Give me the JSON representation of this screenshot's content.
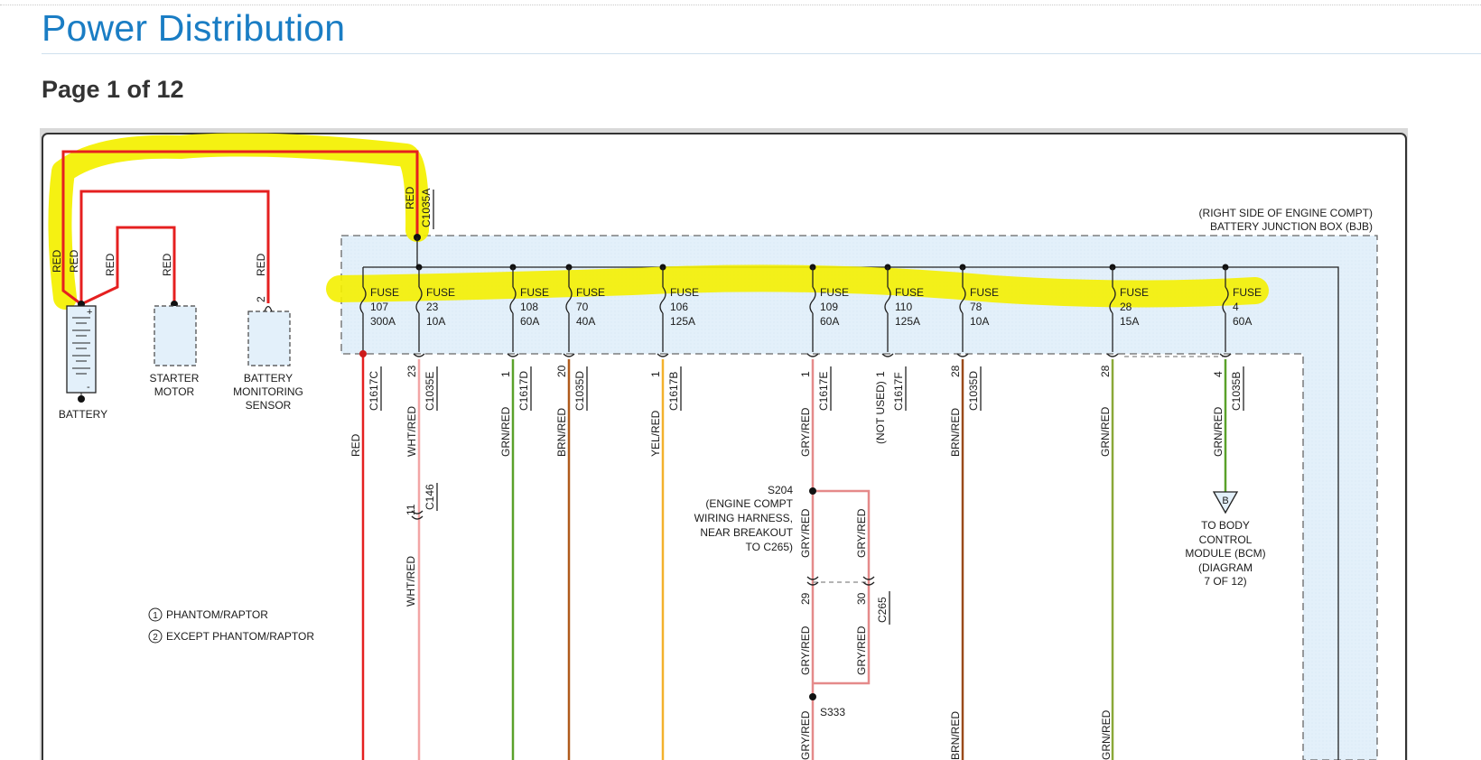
{
  "header": {
    "title": "Power Distribution",
    "page_indicator": "Page 1 of 12"
  },
  "diagram": {
    "junction_box": {
      "location": "(RIGHT SIDE OF ENGINE COMPT)",
      "name": "BATTERY JUNCTION BOX (BJB)"
    },
    "feed": {
      "color": "RED",
      "connector": "C1035A"
    },
    "fuses": [
      {
        "id": "f107",
        "label": "FUSE",
        "number": "107",
        "rating": "300A"
      },
      {
        "id": "f23",
        "label": "FUSE",
        "number": "23",
        "rating": "10A"
      },
      {
        "id": "f108",
        "label": "FUSE",
        "number": "108",
        "rating": "60A"
      },
      {
        "id": "f70",
        "label": "FUSE",
        "number": "70",
        "rating": "40A"
      },
      {
        "id": "f106",
        "label": "FUSE",
        "number": "106",
        "rating": "125A"
      },
      {
        "id": "f109",
        "label": "FUSE",
        "number": "109",
        "rating": "60A"
      },
      {
        "id": "f110",
        "label": "FUSE",
        "number": "110",
        "rating": "125A"
      },
      {
        "id": "f78",
        "label": "FUSE",
        "number": "78",
        "rating": "10A"
      },
      {
        "id": "f28",
        "label": "FUSE",
        "number": "28",
        "rating": "15A"
      },
      {
        "id": "f4",
        "label": "FUSE",
        "number": "4",
        "rating": "60A"
      }
    ],
    "circuits": [
      {
        "pin": "",
        "connector": "C1617C",
        "wire": "RED",
        "color": "#e52020"
      },
      {
        "pin": "23",
        "connector": "C1035E",
        "wire": "WHT/RED",
        "color": "#f2a5a5"
      },
      {
        "pin": "1",
        "connector": "C1617D",
        "wire": "GRN/RED",
        "color": "#5aa12a"
      },
      {
        "pin": "20",
        "connector": "C1035D",
        "wire": "BRN/RED",
        "color": "#b05a1c"
      },
      {
        "pin": "1",
        "connector": "C1617B",
        "wire": "YEL/RED",
        "color": "#f3b12c"
      },
      {
        "pin": "1",
        "connector": "C1617E",
        "wire": "GRY/RED",
        "color": "#e58a8a"
      },
      {
        "pin": "1",
        "connector": "C1617F",
        "wire": "(NOT USED)",
        "color": "#555555"
      },
      {
        "pin": "28",
        "connector": "C1035D",
        "wire": "BRN/RED",
        "color": "#9a4a1a"
      },
      {
        "pin": "28",
        "connector": "",
        "wire": "GRN/RED",
        "color": "#8aa838"
      },
      {
        "pin": "4",
        "connector": "C1035B",
        "wire": "GRN/RED",
        "color": "#5aa12a"
      }
    ],
    "battery": {
      "label": "BATTERY",
      "wires": [
        "RED",
        "RED",
        "RED",
        "RED",
        "RED"
      ],
      "starter_motor": [
        "STARTER",
        "MOTOR"
      ],
      "monitoring_sensor": [
        "BATTERY",
        "MONITORING",
        "SENSOR"
      ],
      "sensor_pin": "2"
    },
    "c146": {
      "pin": "11",
      "name": "C146",
      "wire_below": "WHT/RED"
    },
    "splice_s204": {
      "name": "S204",
      "desc": [
        "(ENGINE COMPT",
        "WIRING HARNESS,",
        "NEAR BREAKOUT",
        "TO C265)"
      ],
      "wire_left": "GRY/RED",
      "wire_right": "GRY/RED"
    },
    "c265": {
      "name": "C265",
      "pin_left": "29",
      "pin_right": "30",
      "wire_left_below": "GRY/RED",
      "wire_right_below": "GRY/RED"
    },
    "splice_s333": {
      "name": "S333",
      "wire_below": "GRY/RED"
    },
    "lower_labels": [
      "BRN/RED",
      "GRN/RED"
    ],
    "bcm": {
      "letter": "B",
      "text": [
        "TO BODY",
        "CONTROL",
        "MODULE (BCM)",
        "(DIAGRAM",
        "7 OF 12)"
      ]
    },
    "legend": [
      {
        "num": "1",
        "text": "PHANTOM/RAPTOR"
      },
      {
        "num": "2",
        "text": "EXCEPT PHANTOM/RAPTOR"
      }
    ]
  }
}
